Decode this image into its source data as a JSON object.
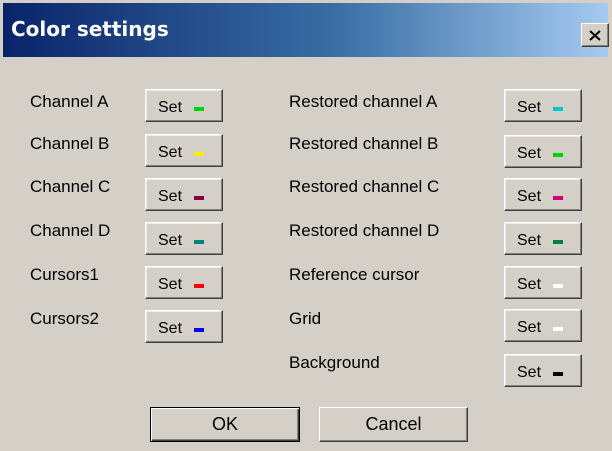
{
  "window": {
    "title": "Color settings",
    "close_label": "✕"
  },
  "left_rows": [
    {
      "label": "Channel A",
      "button": "Set",
      "color": "#00d400"
    },
    {
      "label": "Channel B",
      "button": "Set",
      "color": "#f4f000"
    },
    {
      "label": "Channel C",
      "button": "Set",
      "color": "#800040"
    },
    {
      "label": "Channel D",
      "button": "Set",
      "color": "#008080"
    },
    {
      "label": "Cursors1",
      "button": "Set",
      "color": "#ff0000"
    },
    {
      "label": "Cursors2",
      "button": "Set",
      "color": "#0000ff"
    }
  ],
  "right_rows": [
    {
      "label": "Restored channel A",
      "button": "Set",
      "color": "#00c8c8"
    },
    {
      "label": "Restored channel B",
      "button": "Set",
      "color": "#00d400"
    },
    {
      "label": "Restored channel C",
      "button": "Set",
      "color": "#d4007a"
    },
    {
      "label": "Restored channel D",
      "button": "Set",
      "color": "#008040"
    },
    {
      "label": "Reference cursor",
      "button": "Set",
      "color": "#ffffff"
    },
    {
      "label": "Grid",
      "button": "Set",
      "color": "#ffffff"
    },
    {
      "label": "Background",
      "button": "Set",
      "color": "#000000"
    }
  ],
  "footer": {
    "ok_label": "OK",
    "cancel_label": "Cancel"
  }
}
